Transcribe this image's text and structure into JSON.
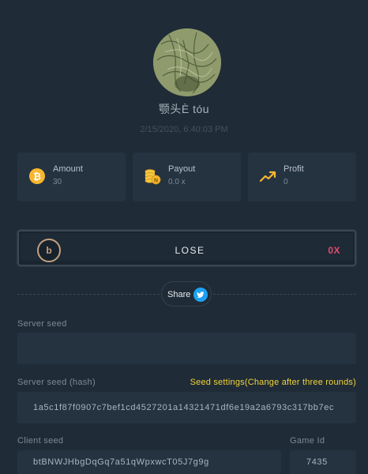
{
  "profile": {
    "username": "颚头È tóu",
    "timestamp": "2/15/2020, 6:40:03 PM"
  },
  "stats": [
    {
      "label": "Amount",
      "value": "30",
      "icon": "bitcoin-icon"
    },
    {
      "label": "Payout",
      "value": "0.0 x",
      "icon": "coin-stack-icon"
    },
    {
      "label": "Profit",
      "value": "0",
      "icon": "trending-up-icon"
    }
  ],
  "result": {
    "label": "LOSE",
    "multiplier": "0X",
    "coin_glyph": "b"
  },
  "share": {
    "label": "Share",
    "icon": "twitter-icon"
  },
  "fields": {
    "server_seed_label": "Server seed",
    "server_seed_value": "",
    "server_seed_hash_label": "Server seed (hash)",
    "seed_settings_link": "Seed settings(Change after three rounds)",
    "server_seed_hash_value": "1a5c1f87f0907c7bef1cd4527201a14321471df6e19a2a6793c317bb7ec",
    "client_seed_label": "Client seed",
    "client_seed_value": "btBNWJHbgDqGq7a51qWpxwcT05J7g9g",
    "game_id_label": "Game Id",
    "game_id_value": "7435"
  },
  "colors": {
    "background": "#1f2b36",
    "card": "#253341",
    "lose": "#e24b6e",
    "seed_settings": "#f1d33b",
    "bitcoin": "#f7b730",
    "twitter": "#1da1f2"
  }
}
